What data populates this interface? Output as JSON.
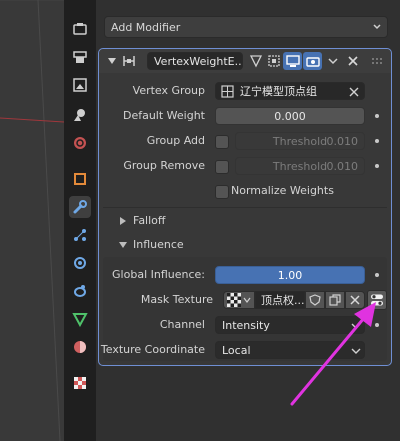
{
  "add_modifier": {
    "label": "Add Modifier"
  },
  "modifier": {
    "name": "VertexWeightE...",
    "vertex_group": {
      "label": "Vertex Group",
      "value": "辽宁模型顶点组"
    },
    "default_weight": {
      "label": "Default Weight",
      "value": "0.000"
    },
    "group_add": {
      "label": "Group Add",
      "placeholder": "Threshold",
      "value": "0.010"
    },
    "group_remove": {
      "label": "Group Remove",
      "placeholder": "Threshold",
      "value": "0.010"
    },
    "normalize": {
      "label": "Normalize Weights"
    },
    "falloff": {
      "label": "Falloff"
    },
    "influence": {
      "label": "Influence",
      "global_influence": {
        "label": "Global Influence:",
        "value": "1.00"
      },
      "mask_texture": {
        "label": "Mask Texture",
        "value": "顶点权..."
      },
      "channel": {
        "label": "Channel",
        "value": "Intensity"
      },
      "texture_coordinate": {
        "label": "Texture Coordinate",
        "value": "Local"
      }
    }
  },
  "colors": {
    "accent_blue": "#4772b3",
    "panel_outline": "#6f8fd4",
    "annotation_arrow": "#e033e0"
  },
  "icons": [
    "tool-icon",
    "render-icon",
    "output-icon",
    "view-layer-icon",
    "scene-icon",
    "world-icon",
    "object-icon",
    "modifier-wrench-icon",
    "particles-icon",
    "physics-icon",
    "constraints-icon",
    "data-icon",
    "material-icon",
    "texture-icon"
  ]
}
